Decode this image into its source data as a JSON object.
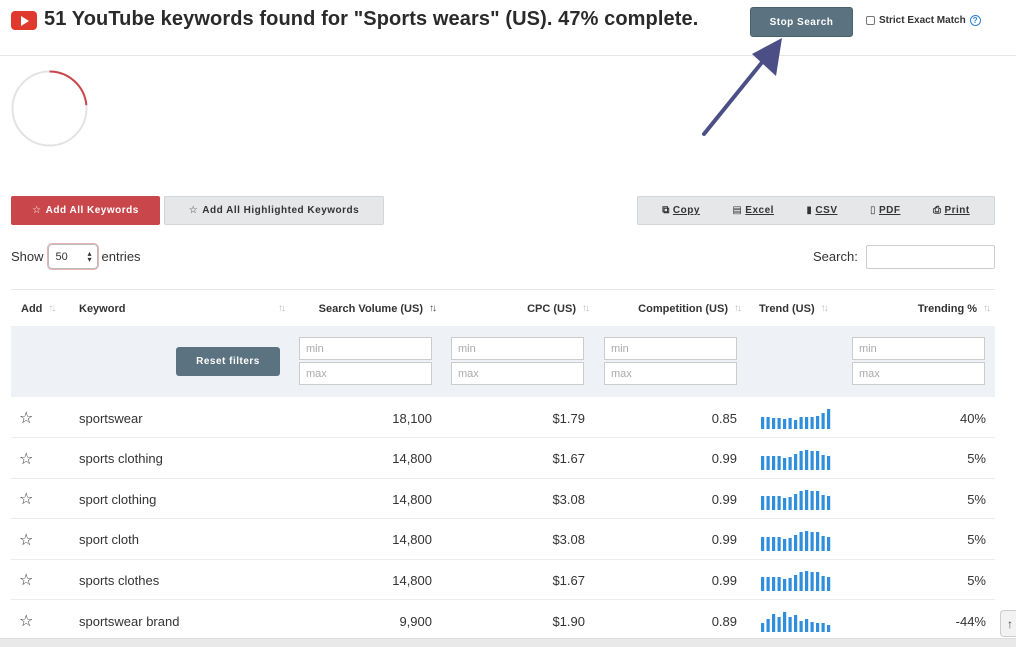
{
  "header": {
    "title": "51 YouTube keywords found for \"Sports wears\" (US). 47% complete.",
    "progress_percent": 47,
    "stop_button": "Stop Search",
    "strict_label": "Strict Exact Match",
    "help_glyph": "?"
  },
  "toolbar": {
    "add_all": "Add All Keywords",
    "add_highlighted": "Add All Highlighted Keywords",
    "export": [
      {
        "label": "Copy",
        "icon": "copy-icon"
      },
      {
        "label": "Excel",
        "icon": "excel-icon"
      },
      {
        "label": "CSV",
        "icon": "csv-icon"
      },
      {
        "label": "PDF",
        "icon": "pdf-icon"
      },
      {
        "label": "Print",
        "icon": "print-icon"
      }
    ]
  },
  "entries": {
    "show_label": "Show",
    "value": "50",
    "suffix": "entries",
    "search_label": "Search:"
  },
  "table": {
    "columns": [
      "Add",
      "Keyword",
      "Search Volume (US)",
      "CPC (US)",
      "Competition (US)",
      "Trend (US)",
      "Trending %"
    ],
    "reset_label": "Reset filters",
    "filter_min": "min",
    "filter_max": "max",
    "rows": [
      {
        "keyword": "sportswear",
        "volume": "18,100",
        "cpc": "$1.79",
        "competition": "0.85",
        "trending": "40%",
        "trend": [
          0.6,
          0.6,
          0.55,
          0.55,
          0.5,
          0.55,
          0.45,
          0.6,
          0.6,
          0.6,
          0.65,
          0.8,
          1.0
        ]
      },
      {
        "keyword": "sports clothing",
        "volume": "14,800",
        "cpc": "$1.67",
        "competition": "0.99",
        "trending": "5%",
        "trend": [
          0.7,
          0.7,
          0.7,
          0.7,
          0.6,
          0.65,
          0.8,
          0.95,
          1.0,
          0.95,
          0.95,
          0.75,
          0.7
        ]
      },
      {
        "keyword": "sport clothing",
        "volume": "14,800",
        "cpc": "$3.08",
        "competition": "0.99",
        "trending": "5%",
        "trend": [
          0.7,
          0.7,
          0.7,
          0.7,
          0.6,
          0.65,
          0.8,
          0.95,
          1.0,
          0.95,
          0.95,
          0.75,
          0.7
        ]
      },
      {
        "keyword": "sport cloth",
        "volume": "14,800",
        "cpc": "$3.08",
        "competition": "0.99",
        "trending": "5%",
        "trend": [
          0.7,
          0.7,
          0.7,
          0.7,
          0.6,
          0.65,
          0.8,
          0.95,
          1.0,
          0.95,
          0.95,
          0.75,
          0.7
        ]
      },
      {
        "keyword": "sports clothes",
        "volume": "14,800",
        "cpc": "$1.67",
        "competition": "0.99",
        "trending": "5%",
        "trend": [
          0.7,
          0.7,
          0.7,
          0.7,
          0.6,
          0.65,
          0.8,
          0.95,
          1.0,
          0.95,
          0.95,
          0.75,
          0.7
        ]
      },
      {
        "keyword": "sportswear brand",
        "volume": "9,900",
        "cpc": "$1.90",
        "competition": "0.89",
        "trending": "-44%",
        "trend": [
          0.45,
          0.65,
          0.9,
          0.75,
          1.0,
          0.75,
          0.85,
          0.55,
          0.65,
          0.5,
          0.45,
          0.45,
          0.35
        ]
      }
    ]
  },
  "colors": {
    "accent_red": "#c9474a",
    "slate": "#5b7380",
    "trend_blue": "#2f8fdd",
    "arrow": "#4b4f86"
  }
}
